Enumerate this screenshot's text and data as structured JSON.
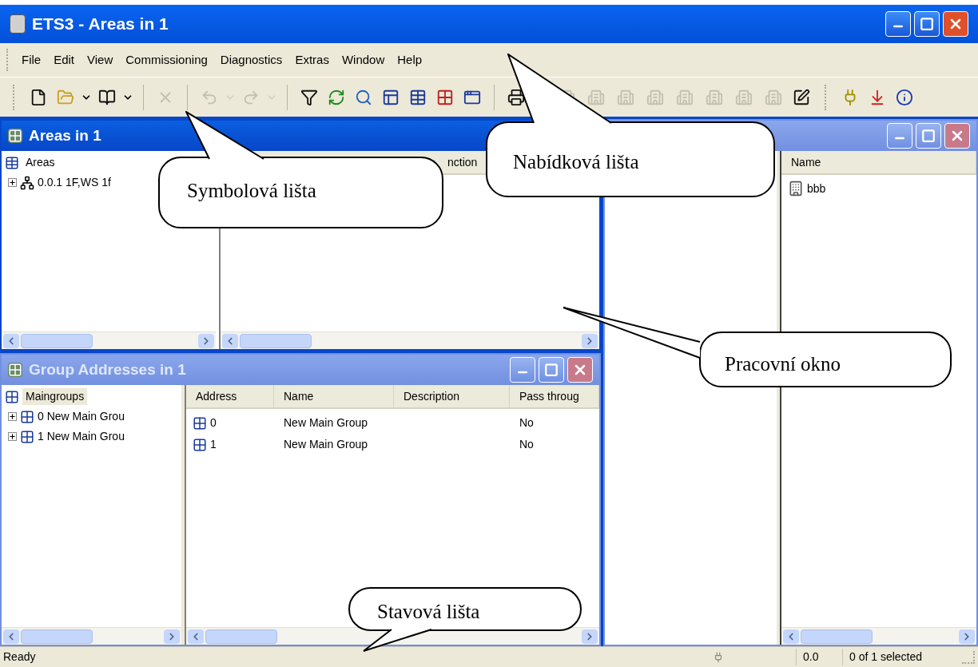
{
  "window": {
    "title": "ETS3 - Areas in 1"
  },
  "menu": [
    {
      "label": "File"
    },
    {
      "label": "Edit"
    },
    {
      "label": "View"
    },
    {
      "label": "Commissioning"
    },
    {
      "label": "Diagnostics"
    },
    {
      "label": "Extras"
    },
    {
      "label": "Window"
    },
    {
      "label": "Help"
    }
  ],
  "toolbar": [
    {
      "kind": "grip"
    },
    {
      "kind": "new",
      "disabled": false
    },
    {
      "kind": "open",
      "disabled": false
    },
    {
      "kind": "caret",
      "disabled": false
    },
    {
      "kind": "catalog",
      "disabled": false
    },
    {
      "kind": "caret",
      "disabled": false
    },
    {
      "kind": "sep"
    },
    {
      "kind": "delete",
      "disabled": true
    },
    {
      "kind": "sep"
    },
    {
      "kind": "undo",
      "disabled": true
    },
    {
      "kind": "caret",
      "disabled": true
    },
    {
      "kind": "redo",
      "disabled": true
    },
    {
      "kind": "caret",
      "disabled": true
    },
    {
      "kind": "sep"
    },
    {
      "kind": "filter",
      "disabled": false
    },
    {
      "kind": "refresh",
      "disabled": false
    },
    {
      "kind": "find",
      "disabled": false
    },
    {
      "kind": "panel",
      "disabled": false
    },
    {
      "kind": "table",
      "disabled": false
    },
    {
      "kind": "grid",
      "disabled": false
    },
    {
      "kind": "window",
      "disabled": false
    },
    {
      "kind": "sep"
    },
    {
      "kind": "print",
      "disabled": false
    },
    {
      "kind": "grip"
    },
    {
      "kind": "building",
      "disabled": true
    },
    {
      "kind": "building",
      "disabled": true
    },
    {
      "kind": "building",
      "disabled": true
    },
    {
      "kind": "building",
      "disabled": true
    },
    {
      "kind": "building",
      "disabled": true
    },
    {
      "kind": "building",
      "disabled": true
    },
    {
      "kind": "building",
      "disabled": true
    },
    {
      "kind": "building",
      "disabled": true
    },
    {
      "kind": "edit",
      "disabled": false
    },
    {
      "kind": "grip"
    },
    {
      "kind": "plug",
      "disabled": false
    },
    {
      "kind": "download",
      "disabled": false
    },
    {
      "kind": "info",
      "disabled": false
    }
  ],
  "areas_window": {
    "title": "Areas in 1",
    "active": true,
    "tree": {
      "label": "Areas",
      "selected": false,
      "children": [
        {
          "label": "0.0.1 1F,WS 1f",
          "expanded": false
        }
      ]
    },
    "list": {
      "columns": [
        "nction"
      ]
    }
  },
  "group_window": {
    "title": "Group Addresses in 1",
    "active": false,
    "tree": {
      "label": "Maingroups",
      "selected": true,
      "children": [
        {
          "label": "0 New Main Grou",
          "expanded": false
        },
        {
          "label": "1 New Main Grou",
          "expanded": false
        }
      ]
    },
    "list": {
      "columns": [
        "Address",
        "Name",
        "Description",
        "Pass throug"
      ],
      "rows": [
        [
          "0",
          "New Main Group",
          "",
          "No"
        ],
        [
          "1",
          "New Main Group",
          "",
          "No"
        ]
      ]
    }
  },
  "right_window": {
    "active": false,
    "list": {
      "columns": [
        "Name"
      ],
      "rows": [
        "bbb"
      ]
    }
  },
  "status_bar": {
    "message": "Ready",
    "coordinate": "0.0",
    "selection": "0 of 1 selected"
  },
  "callouts": [
    {
      "text": "Symbolová lišta"
    },
    {
      "text": "Nabídková lišta"
    },
    {
      "text": "Pracovní okno"
    },
    {
      "text": "Stavová lišta"
    }
  ]
}
